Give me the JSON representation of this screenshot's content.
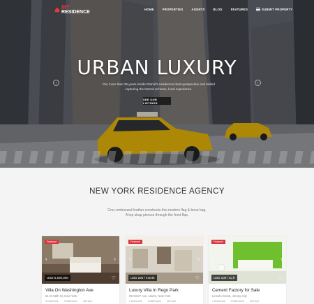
{
  "brand": {
    "logo_top": "MY",
    "logo_bottom": "RESIDENCE"
  },
  "nav": {
    "items": [
      "HOME",
      "PROPERTIES",
      "AGENTS",
      "BLOG",
      "FEATURES"
    ],
    "submit_label": "SUBMIT PROPERTY"
  },
  "hero": {
    "title": "URBAN LUXURY",
    "subtitle": "Our more than 25 years inside Detroit's residences best perspective and skilled capturing the Detroit at home, local experience.",
    "button": "SEE OUR LISTINGS"
  },
  "section": {
    "title": "NEW YORK RESIDENCE AGENCY",
    "subtitle_line1": "Croc-embossed leather constructs this modern flag & bone bag.",
    "subtitle_line2": "A top strap pierces through the front flap."
  },
  "cards": [
    {
      "badge": "Featured",
      "price": "USD 5,500,000",
      "name": "Villa On Washington Ave",
      "address": "51 W 68th St, New York",
      "meta": [
        "4 bedrooms",
        "2 bathrooms",
        "180 sq ft"
      ]
    },
    {
      "badge": "Featured",
      "price": "USD 250 / month",
      "name": "Luxury Villa In Rego Park",
      "address": "95-03 57 Ave, 11101, New York",
      "meta": [
        "2 bedrooms",
        "1 bathrooms",
        "120 sq ft"
      ]
    },
    {
      "badge": "Featured",
      "price": "USD 100 / sq ft",
      "name": "Cement Factory for Sale",
      "address": "Lincoln Street, Jersey City",
      "meta": [
        "1 bedrooms",
        "1 bathrooms",
        "400 sq ft"
      ]
    }
  ],
  "colors": {
    "accent": "#d9363e",
    "taxi": "#e8b400",
    "dark": "#1f1f1f"
  }
}
